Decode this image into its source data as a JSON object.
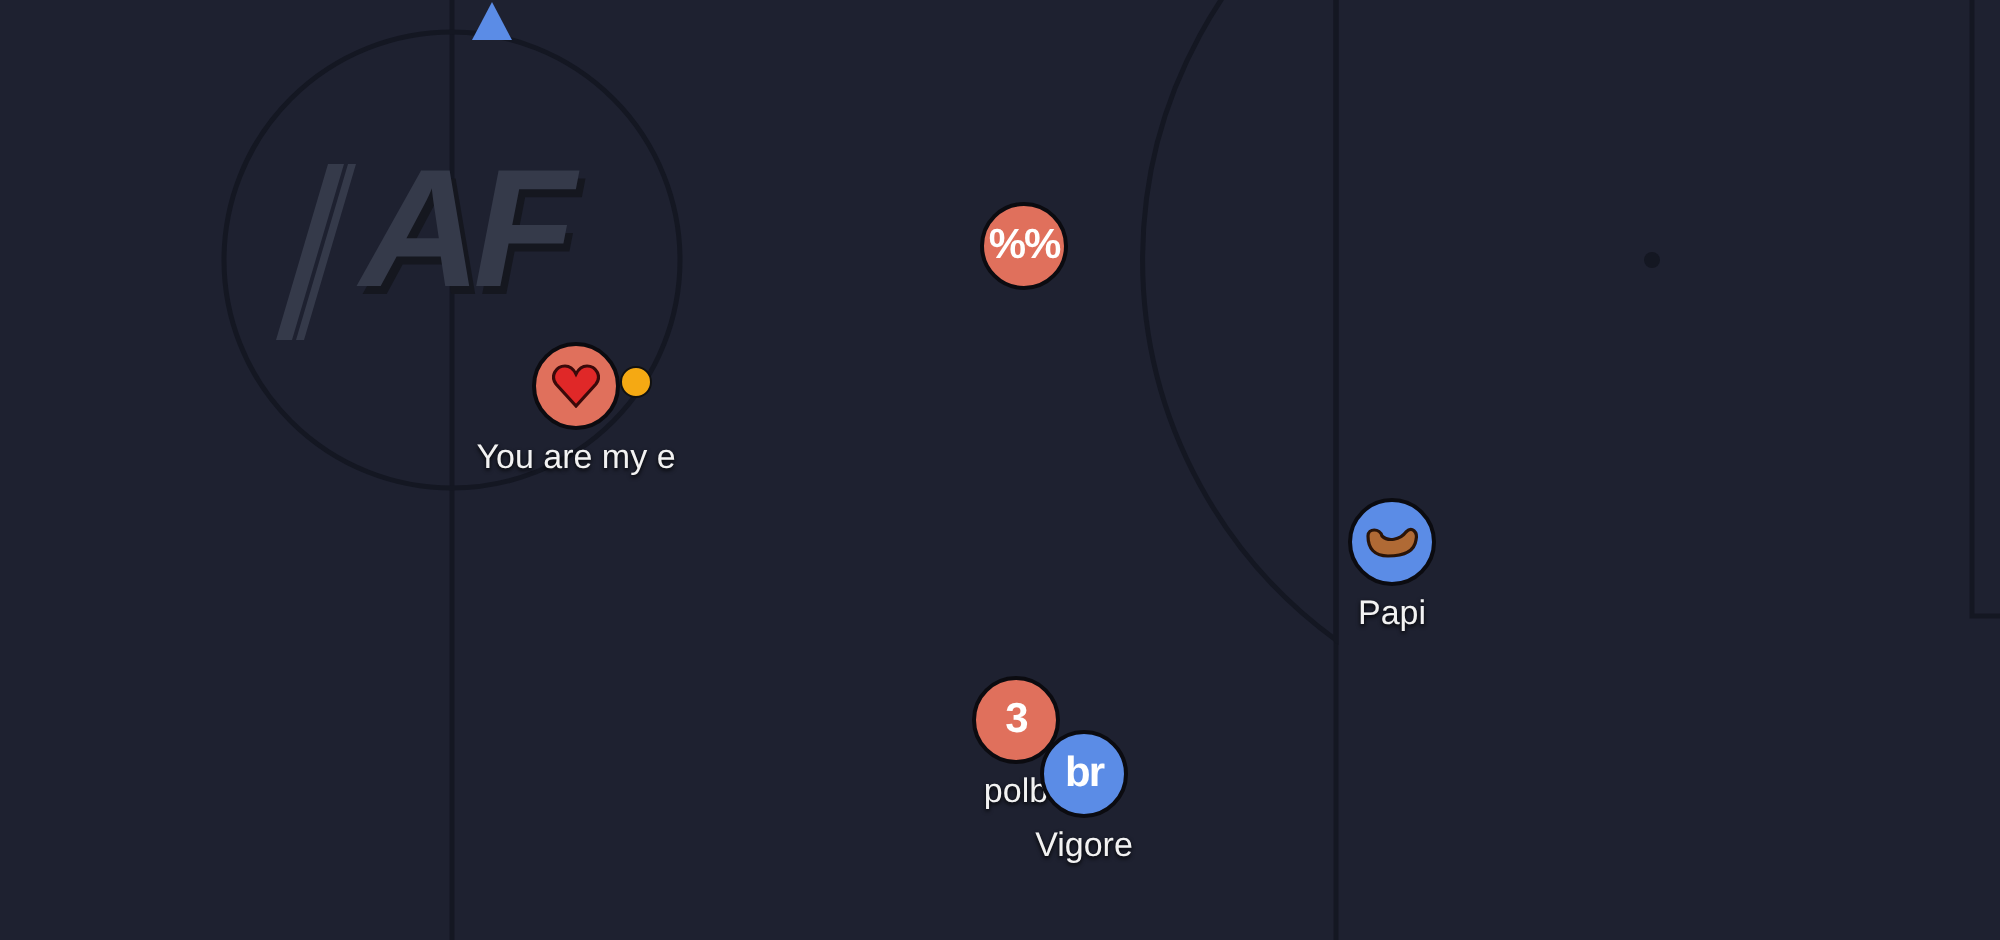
{
  "pitch": {
    "logo": "AF",
    "marker": {
      "kind": "triangle"
    }
  },
  "players": [
    {
      "kind": "heart",
      "color": "#e0705c",
      "online": true,
      "name": "You are my e"
    },
    {
      "kind": "text",
      "color": "#e0705c",
      "online": false,
      "avatar_text": "%%"
    },
    {
      "kind": "text",
      "color": "#e0705c",
      "online": false,
      "avatar_text": "3",
      "name": "polb"
    },
    {
      "kind": "text",
      "color": "#5b8ce6",
      "online": false,
      "avatar_text": "br",
      "name": "Vigore"
    },
    {
      "kind": "food",
      "color": "#5b8ce6",
      "online": false,
      "name": "Papi"
    }
  ]
}
